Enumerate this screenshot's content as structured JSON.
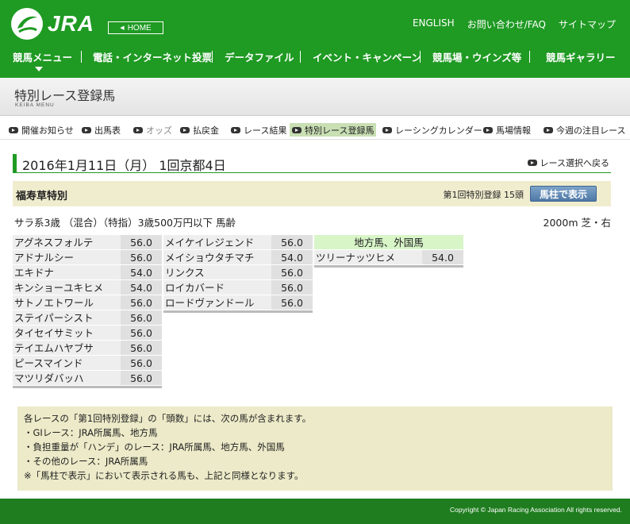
{
  "header": {
    "logo_text": "JRA",
    "home_label": "HOME",
    "util_links": [
      "ENGLISH",
      "お問い合わせ/FAQ",
      "サイトマップ"
    ],
    "gnav": [
      "競馬メニュー",
      "電話・インターネット投票",
      "データファイル",
      "イベント・キャンペーン",
      "競馬場・ウインズ等",
      "競馬ギャラリー"
    ]
  },
  "subhead": {
    "title": "特別レース登録馬",
    "subtitle": "KEIBA MENU"
  },
  "subnav": [
    "開催お知らせ",
    "出馬表",
    "オッズ",
    "払戻金",
    "レース結果",
    "特別レース登録馬",
    "レーシングカレンダー",
    "馬場情報",
    "今週の注目レース"
  ],
  "date_heading": "2016年1月11日（月） 1回京都4日",
  "back_link": "レース選択へ戻る",
  "race": {
    "name": "福寿草特別",
    "registration": "第1回特別登録 15頭",
    "button": "馬柱で表示",
    "conditions": "サラ系3歳 （混合）（特指）3歳500万円以下 馬齢",
    "distance": "2000m 芝・右"
  },
  "horses": {
    "col1": [
      {
        "name": "アグネスフォルテ",
        "weight": "56.0"
      },
      {
        "name": "アドナルシー",
        "weight": "56.0"
      },
      {
        "name": "エキドナ",
        "weight": "54.0"
      },
      {
        "name": "キンショーユキヒメ",
        "weight": "54.0"
      },
      {
        "name": "サトノエトワール",
        "weight": "56.0"
      },
      {
        "name": "ステイパーシスト",
        "weight": "56.0"
      },
      {
        "name": "タイセイサミット",
        "weight": "56.0"
      },
      {
        "name": "テイエムハヤブサ",
        "weight": "56.0"
      },
      {
        "name": "ピースマインド",
        "weight": "56.0"
      },
      {
        "name": "マツリダバッハ",
        "weight": "56.0"
      }
    ],
    "col2": [
      {
        "name": "メイケイレジェンド",
        "weight": "56.0"
      },
      {
        "name": "メイショウタチマチ",
        "weight": "54.0"
      },
      {
        "name": "リンクス",
        "weight": "56.0"
      },
      {
        "name": "ロイカバード",
        "weight": "56.0"
      },
      {
        "name": "ロードヴァンドール",
        "weight": "56.0"
      }
    ],
    "col3_header": "地方馬、外国馬",
    "col3": [
      {
        "name": "ツリーナッツヒメ",
        "weight": "54.0"
      }
    ]
  },
  "note_lines": [
    "各レースの「第1回特別登録」の「頭数」には、次の馬が含まれます。",
    "・GIレース：JRA所属馬、地方馬",
    "・負担重量が「ハンデ」のレース：JRA所属馬、地方馬、外国馬",
    "・その他のレース：JRA所属馬",
    "※「馬柱で表示」において表示される馬も、上記と同様となります。"
  ],
  "footer": "Copyright © Japan Racing Association All rights reserved.",
  "colors": {
    "brand_green": "#1f9a23",
    "footer_green": "#1f7d1f",
    "note_bg": "#eceac8"
  }
}
